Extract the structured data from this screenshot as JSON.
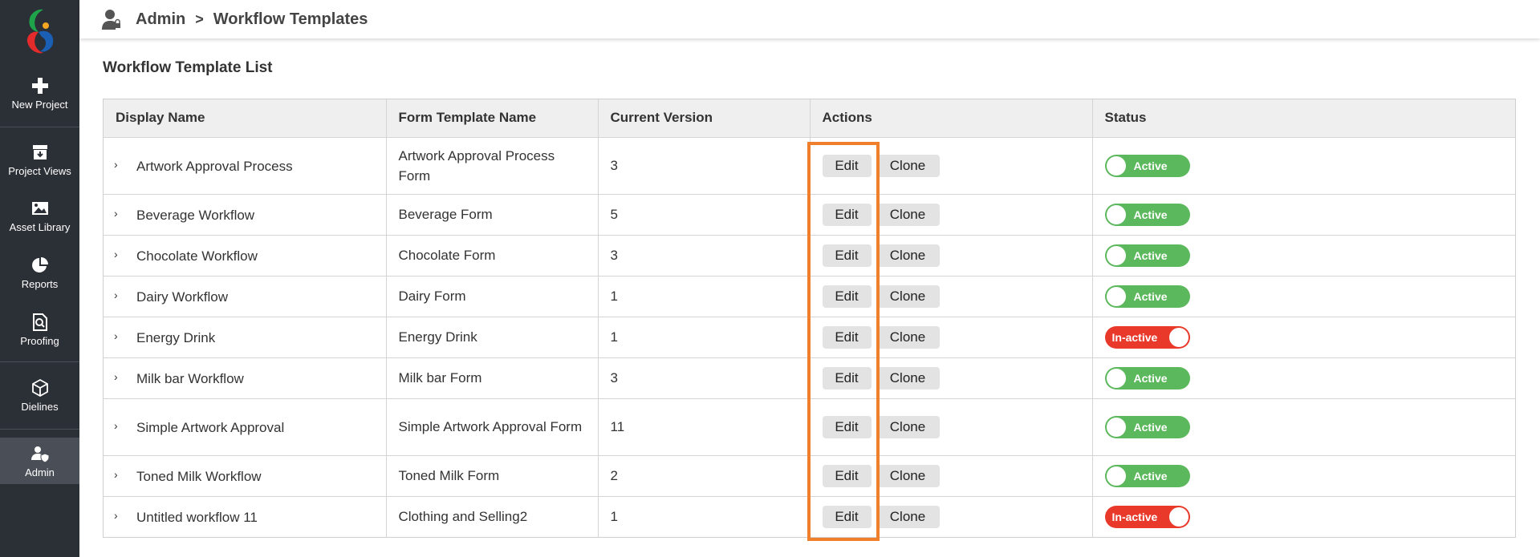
{
  "sidebar": {
    "items": [
      {
        "label": "New Project",
        "icon": "plus-icon"
      },
      {
        "label": "Project Views",
        "icon": "archive-icon"
      },
      {
        "label": "Asset Library",
        "icon": "image-icon"
      },
      {
        "label": "Reports",
        "icon": "pie-chart-icon"
      },
      {
        "label": "Proofing",
        "icon": "document-search-icon"
      },
      {
        "label": "Dielines",
        "icon": "box-icon"
      },
      {
        "label": "Admin",
        "icon": "user-shield-icon"
      }
    ],
    "active": "Admin"
  },
  "header": {
    "breadcrumb_root": "Admin",
    "breadcrumb_sep": ">",
    "breadcrumb_current": "Workflow Templates"
  },
  "main": {
    "title": "Workflow Template List",
    "columns": [
      "Display Name",
      "Form Template Name",
      "Current Version",
      "Actions",
      "Status"
    ],
    "edit_label": "Edit",
    "clone_label": "Clone",
    "rows": [
      {
        "display_name": "Artwork Approval Process",
        "form_name": "Artwork Approval Process Form",
        "version": "3",
        "status": "Active"
      },
      {
        "display_name": "Beverage Workflow",
        "form_name": "Beverage Form",
        "version": "5",
        "status": "Active"
      },
      {
        "display_name": "Chocolate Workflow",
        "form_name": "Chocolate Form",
        "version": "3",
        "status": "Active"
      },
      {
        "display_name": "Dairy Workflow",
        "form_name": "Dairy Form",
        "version": "1",
        "status": "Active"
      },
      {
        "display_name": "Energy Drink",
        "form_name": "Energy Drink",
        "version": "1",
        "status": "In-active"
      },
      {
        "display_name": "Milk bar Workflow",
        "form_name": "Milk bar Form",
        "version": "3",
        "status": "Active"
      },
      {
        "display_name": "Simple Artwork Approval",
        "form_name": "Simple Artwork Approval Form",
        "version": "11",
        "status": "Active"
      },
      {
        "display_name": "Toned Milk Workflow",
        "form_name": "Toned Milk Form",
        "version": "2",
        "status": "Active"
      },
      {
        "display_name": "Untitled workflow 11",
        "form_name": "Clothing and Selling2",
        "version": "1",
        "status": "In-active"
      }
    ]
  },
  "colors": {
    "sidebar_bg": "#2b2f36",
    "active_green": "#5cb85c",
    "inactive_red": "#e8392b",
    "highlight_orange": "#f07f2c"
  }
}
